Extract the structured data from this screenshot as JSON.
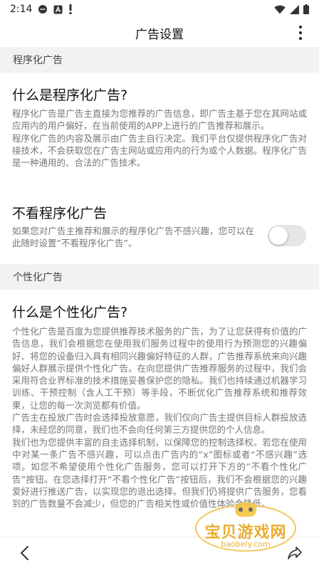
{
  "status": {
    "time": "2:14"
  },
  "header": {
    "title": "广告设置"
  },
  "sections": {
    "programmatic_header": "程序化广告",
    "personalized_header": "个性化广告"
  },
  "programmatic": {
    "title": "什么是程序化广告?",
    "desc1": "程序化广告是广告主直接为您推荐的广告信息，即广告主基于您在其网站或应用内的用户偏好，在当前使用的APP上进行的广告推荐和展示。",
    "desc2": "程序化广告的内容及展示由广告主自行决定。我们平台仅提供程序化广告对接技术，不会获取您在广告主网站或应用内的行为或个人数据。程序化广告是一种通用的、合法的广告技术。"
  },
  "opt_out": {
    "title": "不看程序化广告",
    "desc": "如果您对广告主推荐和展示的程序化广告不感兴趣，您可以在此随时设置“不看程序化广告”。",
    "toggle_on": false
  },
  "personalized": {
    "title": "什么是个性化广告?",
    "desc1": "个性化广告是百度为您提供推荐技术服务的广告，为了让您获得有价值的广告信息，我们会根据您在使用我们服务过程中的使用行为预测您的兴趣偏好、将您的设备归入具有相同兴趣偏好特征的人群，广告推荐系统来向兴趣偏好人群展示提供个性化广告。在向您提供广告推荐服务的过程中，我们会采用符合业界标准的技术措施妥善保护您的隐私。我们也持续通过机器学习训练、干预控制（含人工干预）等手段，不断优化广告推荐系统和推荐效果，让您的每一次浏览都有价值。",
    "desc2": "广告主在投放广告时会选择投放意愿，我们仅向广告主提供目标人群投放选择，未经您的同意，我们也不会向任何第三方提供您的个人信息。",
    "desc3": "我们也为您提供丰富的自主选择机制，以保障您的控制选择权。若您在使用中对某一条广告不感兴趣，可以点击广告内的“x”图标或者“不感兴趣”选项。如您不希望使用个性化广告服务，您可以打开下方的“不看个性化广告”按钮。在您选择打开“不看个性化广告”按钮后，我们不会根据您的兴趣爱好进行推送广告，以实现您的退出选择。但我们仍将提供广告服务，您看到的广告数量不会减少，但您的广告相关性或价值性体验会降低。"
  },
  "watermark": {
    "text": "宝贝游戏网",
    "url": "baobeiy.com"
  },
  "colors": {
    "section_bg": "#f2f2f2",
    "toggle_track": "#e6e6e6",
    "watermark": "#e7a61a"
  }
}
